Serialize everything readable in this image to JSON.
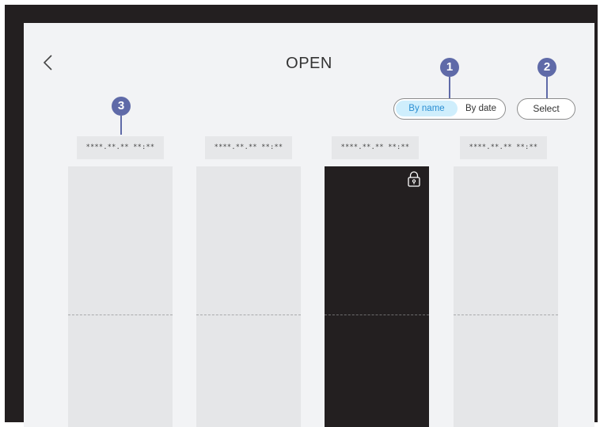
{
  "header": {
    "title": "OPEN"
  },
  "sort": {
    "by_name": "By name",
    "by_date": "By date",
    "active": "By name"
  },
  "select_label": "Select",
  "callouts": [
    "1",
    "2",
    "3"
  ],
  "pages": [
    {
      "date": "****.**.** **:**",
      "locked": false
    },
    {
      "date": "****.**.** **:**",
      "locked": false
    },
    {
      "date": "****.**.** **:**",
      "locked": true
    },
    {
      "date": "****.**.** **:**",
      "locked": false
    }
  ],
  "icons": {
    "back": "chevron-left-icon",
    "lock": "lock-icon"
  },
  "colors": {
    "background": "#f2f3f5",
    "accent": "#2a8ed3",
    "callout": "#5f6aa8",
    "active_pill": "#cfeefc"
  }
}
